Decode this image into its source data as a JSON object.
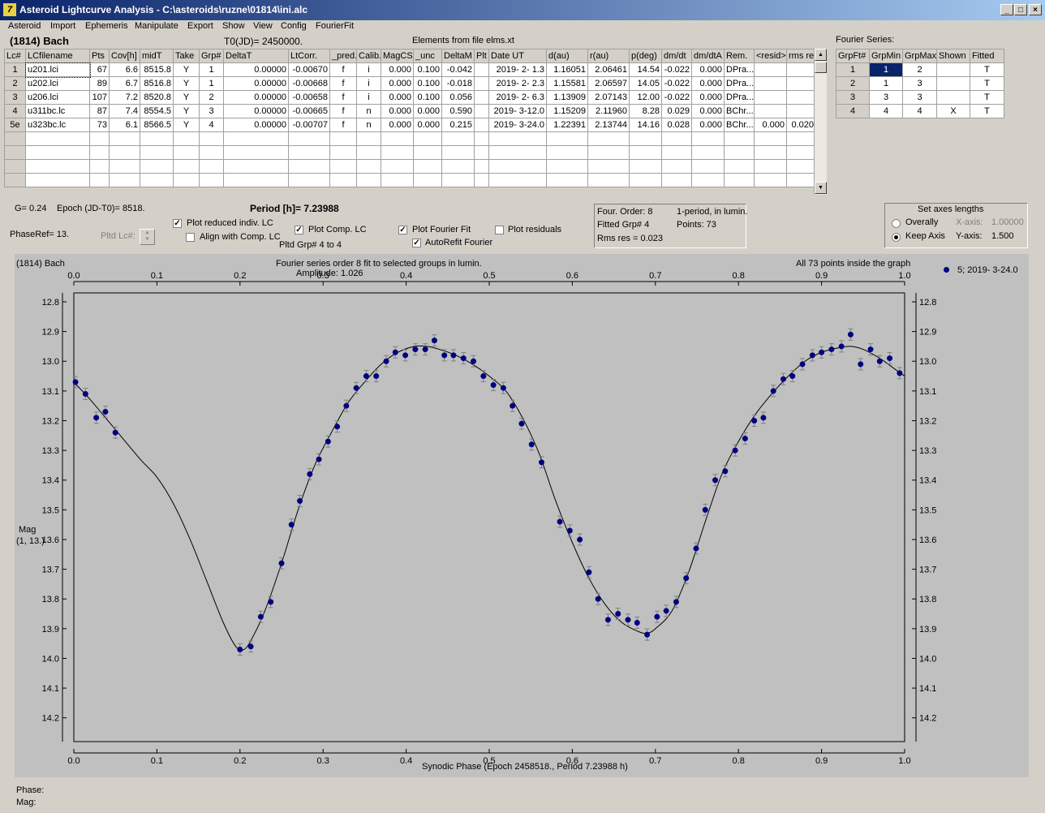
{
  "window": {
    "title": "Asteroid Lightcurve Analysis - C:\\asteroids\\ruzne\\01814\\ini.alc",
    "icon": "7"
  },
  "menu": [
    "Asteroid",
    "Import",
    "Ephemeris",
    "Manipulate",
    "Export",
    "Show",
    "View",
    "Config",
    "FourierFit"
  ],
  "header": {
    "asteroid": "(1814) Bach",
    "t0": "T0(JD)= 2450000.",
    "elements": "Elements from file elms.xt"
  },
  "lc_table": {
    "columns": [
      "Lc#",
      "LCfilename",
      "Pts",
      "Cov[h]",
      "midT",
      "Take",
      "Grp#",
      "DeltaT",
      "LtCorr.",
      "_pred.",
      "Calib.",
      "MagCS",
      "_unc",
      "DeltaM",
      "Plt",
      "Date UT",
      "d(au)",
      "r(au)",
      "p(deg)",
      "dm/dt",
      "dm/dtA",
      "Rem.",
      "<resid>",
      "rms res"
    ],
    "rows": [
      [
        "1",
        "u201.lci",
        "67",
        "6.6",
        "8515.8",
        "Y",
        "1",
        "0.00000",
        "-0.00670",
        "f",
        "i",
        "0.000",
        "0.100",
        "-0.042",
        "",
        "2019- 2- 1.3",
        "1.16051",
        "2.06461",
        "14.54",
        "-0.022",
        "0.000",
        "DPra...",
        "",
        ""
      ],
      [
        "2",
        "u202.lci",
        "89",
        "6.7",
        "8516.8",
        "Y",
        "1",
        "0.00000",
        "-0.00668",
        "f",
        "i",
        "0.000",
        "0.100",
        "-0.018",
        "",
        "2019- 2- 2.3",
        "1.15581",
        "2.06597",
        "14.05",
        "-0.022",
        "0.000",
        "DPra...",
        "",
        ""
      ],
      [
        "3",
        "u206.lci",
        "107",
        "7.2",
        "8520.8",
        "Y",
        "2",
        "0.00000",
        "-0.00658",
        "f",
        "i",
        "0.000",
        "0.100",
        "0.056",
        "",
        "2019- 2- 6.3",
        "1.13909",
        "2.07143",
        "12.00",
        "-0.022",
        "0.000",
        "DPra...",
        "",
        ""
      ],
      [
        "4",
        "u311bc.lc",
        "87",
        "7.4",
        "8554.5",
        "Y",
        "3",
        "0.00000",
        "-0.00665",
        "f",
        "n",
        "0.000",
        "0.000",
        "0.590",
        "",
        "2019- 3-12.0",
        "1.15209",
        "2.11960",
        "8.28",
        "0.029",
        "0.000",
        "BChr...",
        "",
        ""
      ],
      [
        "5e",
        "u323bc.lc",
        "73",
        "6.1",
        "8566.5",
        "Y",
        "4",
        "0.00000",
        "-0.00707",
        "f",
        "n",
        "0.000",
        "0.000",
        "0.215",
        "",
        "2019- 3-24.0",
        "1.22391",
        "2.13744",
        "14.16",
        "0.028",
        "0.000",
        "BChr...",
        "0.000",
        "0.020"
      ]
    ],
    "empty_rows": 4
  },
  "fourier_table": {
    "title": "Fourier Series:",
    "columns": [
      "GrpFt#",
      "GrpMin",
      "GrpMax",
      "Shown",
      "Fitted"
    ],
    "rows": [
      [
        "1",
        "1",
        "2",
        "",
        "T"
      ],
      [
        "2",
        "1",
        "3",
        "",
        "T"
      ],
      [
        "3",
        "3",
        "3",
        "",
        "T"
      ],
      [
        "4",
        "4",
        "4",
        "X",
        "T"
      ]
    ]
  },
  "controls": {
    "g": "G= 0.24",
    "epoch": "Epoch (JD-T0)= 8518.",
    "period": "Period [h]= 7.23988",
    "phase_ref": "PhaseRef= 13.",
    "pltd_lc": "Pltd Lc#:",
    "plot_reduced": "Plot reduced indiv. LC",
    "align_comp": "Align with Comp. LC",
    "plot_comp": "Plot Comp. LC",
    "pltd_grp": "Pltd Grp#  4   to    4",
    "plot_fourier": "Plot Fourier Fit",
    "autorefit": "AutoRefit Fourier",
    "plot_residuals": "Plot residuals",
    "info_order": "Four. Order:  8",
    "info_period": "1-period, in lumin.",
    "info_fitted": "Fitted Grp# 4",
    "info_points": "Points: 73",
    "info_rms": "Rms res      = 0.023",
    "axes_title": "Set axes lengths",
    "overally": "Overally",
    "keep_axis": "Keep Axis",
    "xaxis_label": "X-axis:",
    "xaxis_value": "1.00000",
    "yaxis_label": "Y-axis:",
    "yaxis_value": "1.500"
  },
  "chart_data": {
    "type": "scatter",
    "top_left": "(1814) Bach",
    "title": "Fourier series order 8 fit to selected groups in lumin.",
    "subtitle": "Amplitude: 1.026",
    "top_right": "All 73 points inside the graph",
    "legend": "5; 2019- 3-24.0",
    "xlabel": "Synodic Phase (Epoch 2458518., Period 7.23988 h)",
    "ylabel": "Mag",
    "ylabel2": "(1, 13.)",
    "xlim": [
      0,
      1
    ],
    "ylim": [
      14.28,
      12.77
    ],
    "xticks": [
      "0.0",
      "0.1",
      "0.2",
      "0.3",
      "0.4",
      "0.5",
      "0.6",
      "0.7",
      "0.8",
      "0.9",
      "1.0"
    ],
    "yticks": [
      "12.8",
      "12.9",
      "13.0",
      "13.1",
      "13.2",
      "13.3",
      "13.4",
      "13.5",
      "13.6",
      "13.7",
      "13.8",
      "13.9",
      "14.0",
      "14.1",
      "14.2"
    ],
    "point_color": "#000080",
    "points": [
      [
        0.002,
        13.07
      ],
      [
        0.014,
        13.11
      ],
      [
        0.027,
        13.19
      ],
      [
        0.038,
        13.17
      ],
      [
        0.05,
        13.24
      ],
      [
        0.2,
        13.97
      ],
      [
        0.213,
        13.96
      ],
      [
        0.225,
        13.86
      ],
      [
        0.237,
        13.81
      ],
      [
        0.25,
        13.68
      ],
      [
        0.262,
        13.55
      ],
      [
        0.272,
        13.47
      ],
      [
        0.284,
        13.38
      ],
      [
        0.295,
        13.33
      ],
      [
        0.306,
        13.27
      ],
      [
        0.317,
        13.22
      ],
      [
        0.328,
        13.15
      ],
      [
        0.34,
        13.09
      ],
      [
        0.352,
        13.05
      ],
      [
        0.364,
        13.05
      ],
      [
        0.376,
        13.0
      ],
      [
        0.387,
        12.97
      ],
      [
        0.399,
        12.98
      ],
      [
        0.411,
        12.96
      ],
      [
        0.423,
        12.96
      ],
      [
        0.434,
        12.93
      ],
      [
        0.446,
        12.98
      ],
      [
        0.457,
        12.98
      ],
      [
        0.469,
        12.99
      ],
      [
        0.481,
        13.0
      ],
      [
        0.493,
        13.05
      ],
      [
        0.505,
        13.08
      ],
      [
        0.517,
        13.09
      ],
      [
        0.528,
        13.15
      ],
      [
        0.539,
        13.21
      ],
      [
        0.551,
        13.28
      ],
      [
        0.563,
        13.34
      ],
      [
        0.585,
        13.54
      ],
      [
        0.597,
        13.57
      ],
      [
        0.609,
        13.6
      ],
      [
        0.62,
        13.71
      ],
      [
        0.631,
        13.8
      ],
      [
        0.643,
        13.87
      ],
      [
        0.655,
        13.85
      ],
      [
        0.667,
        13.87
      ],
      [
        0.678,
        13.88
      ],
      [
        0.69,
        13.92
      ],
      [
        0.702,
        13.86
      ],
      [
        0.713,
        13.84
      ],
      [
        0.725,
        13.81
      ],
      [
        0.737,
        13.73
      ],
      [
        0.749,
        13.63
      ],
      [
        0.76,
        13.5
      ],
      [
        0.772,
        13.4
      ],
      [
        0.784,
        13.37
      ],
      [
        0.796,
        13.3
      ],
      [
        0.808,
        13.26
      ],
      [
        0.819,
        13.2
      ],
      [
        0.83,
        13.19
      ],
      [
        0.842,
        13.1
      ],
      [
        0.854,
        13.06
      ],
      [
        0.865,
        13.05
      ],
      [
        0.877,
        13.01
      ],
      [
        0.889,
        12.98
      ],
      [
        0.9,
        12.97
      ],
      [
        0.912,
        12.96
      ],
      [
        0.924,
        12.95
      ],
      [
        0.935,
        12.91
      ],
      [
        0.947,
        13.01
      ],
      [
        0.959,
        12.96
      ],
      [
        0.97,
        13.0
      ],
      [
        0.982,
        12.99
      ],
      [
        0.994,
        13.04
      ]
    ],
    "fit_curve": [
      [
        0.0,
        13.07
      ],
      [
        0.02,
        13.13
      ],
      [
        0.05,
        13.23
      ],
      [
        0.08,
        13.33
      ],
      [
        0.1,
        13.39
      ],
      [
        0.12,
        13.48
      ],
      [
        0.14,
        13.6
      ],
      [
        0.16,
        13.74
      ],
      [
        0.18,
        13.88
      ],
      [
        0.195,
        13.96
      ],
      [
        0.205,
        13.97
      ],
      [
        0.215,
        13.93
      ],
      [
        0.23,
        13.84
      ],
      [
        0.25,
        13.68
      ],
      [
        0.27,
        13.5
      ],
      [
        0.29,
        13.35
      ],
      [
        0.31,
        13.24
      ],
      [
        0.33,
        13.14
      ],
      [
        0.35,
        13.07
      ],
      [
        0.37,
        13.01
      ],
      [
        0.39,
        12.97
      ],
      [
        0.41,
        12.95
      ],
      [
        0.425,
        12.95
      ],
      [
        0.44,
        12.96
      ],
      [
        0.46,
        12.98
      ],
      [
        0.48,
        13.01
      ],
      [
        0.5,
        13.05
      ],
      [
        0.52,
        13.1
      ],
      [
        0.54,
        13.19
      ],
      [
        0.56,
        13.31
      ],
      [
        0.58,
        13.47
      ],
      [
        0.6,
        13.61
      ],
      [
        0.62,
        13.73
      ],
      [
        0.64,
        13.82
      ],
      [
        0.66,
        13.88
      ],
      [
        0.68,
        13.91
      ],
      [
        0.69,
        13.915
      ],
      [
        0.7,
        13.9
      ],
      [
        0.72,
        13.84
      ],
      [
        0.74,
        13.71
      ],
      [
        0.76,
        13.54
      ],
      [
        0.78,
        13.38
      ],
      [
        0.8,
        13.27
      ],
      [
        0.82,
        13.18
      ],
      [
        0.84,
        13.11
      ],
      [
        0.86,
        13.05
      ],
      [
        0.88,
        13.0
      ],
      [
        0.9,
        12.97
      ],
      [
        0.92,
        12.955
      ],
      [
        0.935,
        12.95
      ],
      [
        0.95,
        12.96
      ],
      [
        0.97,
        12.99
      ],
      [
        0.99,
        13.03
      ],
      [
        1.0,
        13.05
      ]
    ]
  },
  "statusbar": {
    "phase": "Phase:",
    "mag": "Mag:"
  }
}
